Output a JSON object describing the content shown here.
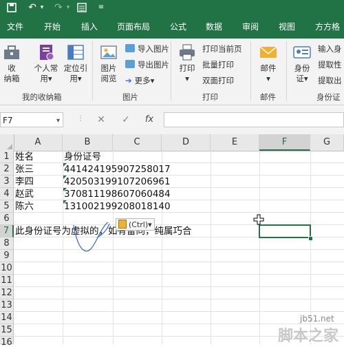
{
  "menu": {
    "tabs": [
      "文件",
      "开始",
      "插入",
      "页面布局",
      "公式",
      "数据",
      "审阅",
      "视图",
      "方方格"
    ]
  },
  "ribbon": {
    "collect": {
      "label1": "收",
      "label2": "纳箱"
    },
    "personal": {
      "label1": "个人常",
      "label2": "用▾"
    },
    "locate": {
      "label1": "定位引",
      "label2": "用▾"
    },
    "picbrowse": {
      "label1": "图片",
      "label2": "阅览"
    },
    "import_pic": "导入图片",
    "export_pic": "导出图片",
    "more": "更多▾",
    "print": {
      "label1": "打印",
      "label2": "▾"
    },
    "print_page": "打印当前页",
    "batch_print": "批量打印",
    "duplex_print": "双面打印",
    "mail": {
      "label1": "邮件",
      "label2": "▾"
    },
    "idcard": {
      "label1": "身份",
      "label2": "证▾"
    },
    "input_id": "输入身",
    "extract1": "提取性",
    "extract2": "提取出",
    "groups": {
      "mybox": "我的收纳箱",
      "picture": "图片",
      "print": "打印",
      "mail": "邮件",
      "idcard": "身份证"
    }
  },
  "formula_bar": {
    "name_box": "F7",
    "cancel": "✕",
    "confirm": "✓",
    "fx": "fx",
    "value": ""
  },
  "sheet": {
    "columns": [
      "A",
      "B",
      "C",
      "D",
      "E",
      "F",
      "G"
    ],
    "active_column": "F",
    "rows": [
      "1",
      "2",
      "3",
      "4",
      "5",
      "6",
      "7",
      "8",
      "9",
      "10",
      "11",
      "12",
      "13",
      "14",
      "15",
      "16"
    ],
    "active_row": "7",
    "cells": {
      "A1": "姓名",
      "B1": "身份证号",
      "A2": "张三",
      "B2": "441424195907258017",
      "A3": "李四",
      "B3": "420503199107206961",
      "A4": "赵武",
      "B4": "370811198607060484",
      "A5": "陈六",
      "B5": "131002199208018140",
      "A7": "此身份证号为虚拟的，如有雷同，纯属巧合"
    },
    "paste_options": "(Ctrl)▾"
  },
  "watermark": {
    "site": "jb51.net",
    "brand": "脚本之家"
  },
  "colors": {
    "accent": "#217346",
    "annotation": "#3a6fd8"
  }
}
